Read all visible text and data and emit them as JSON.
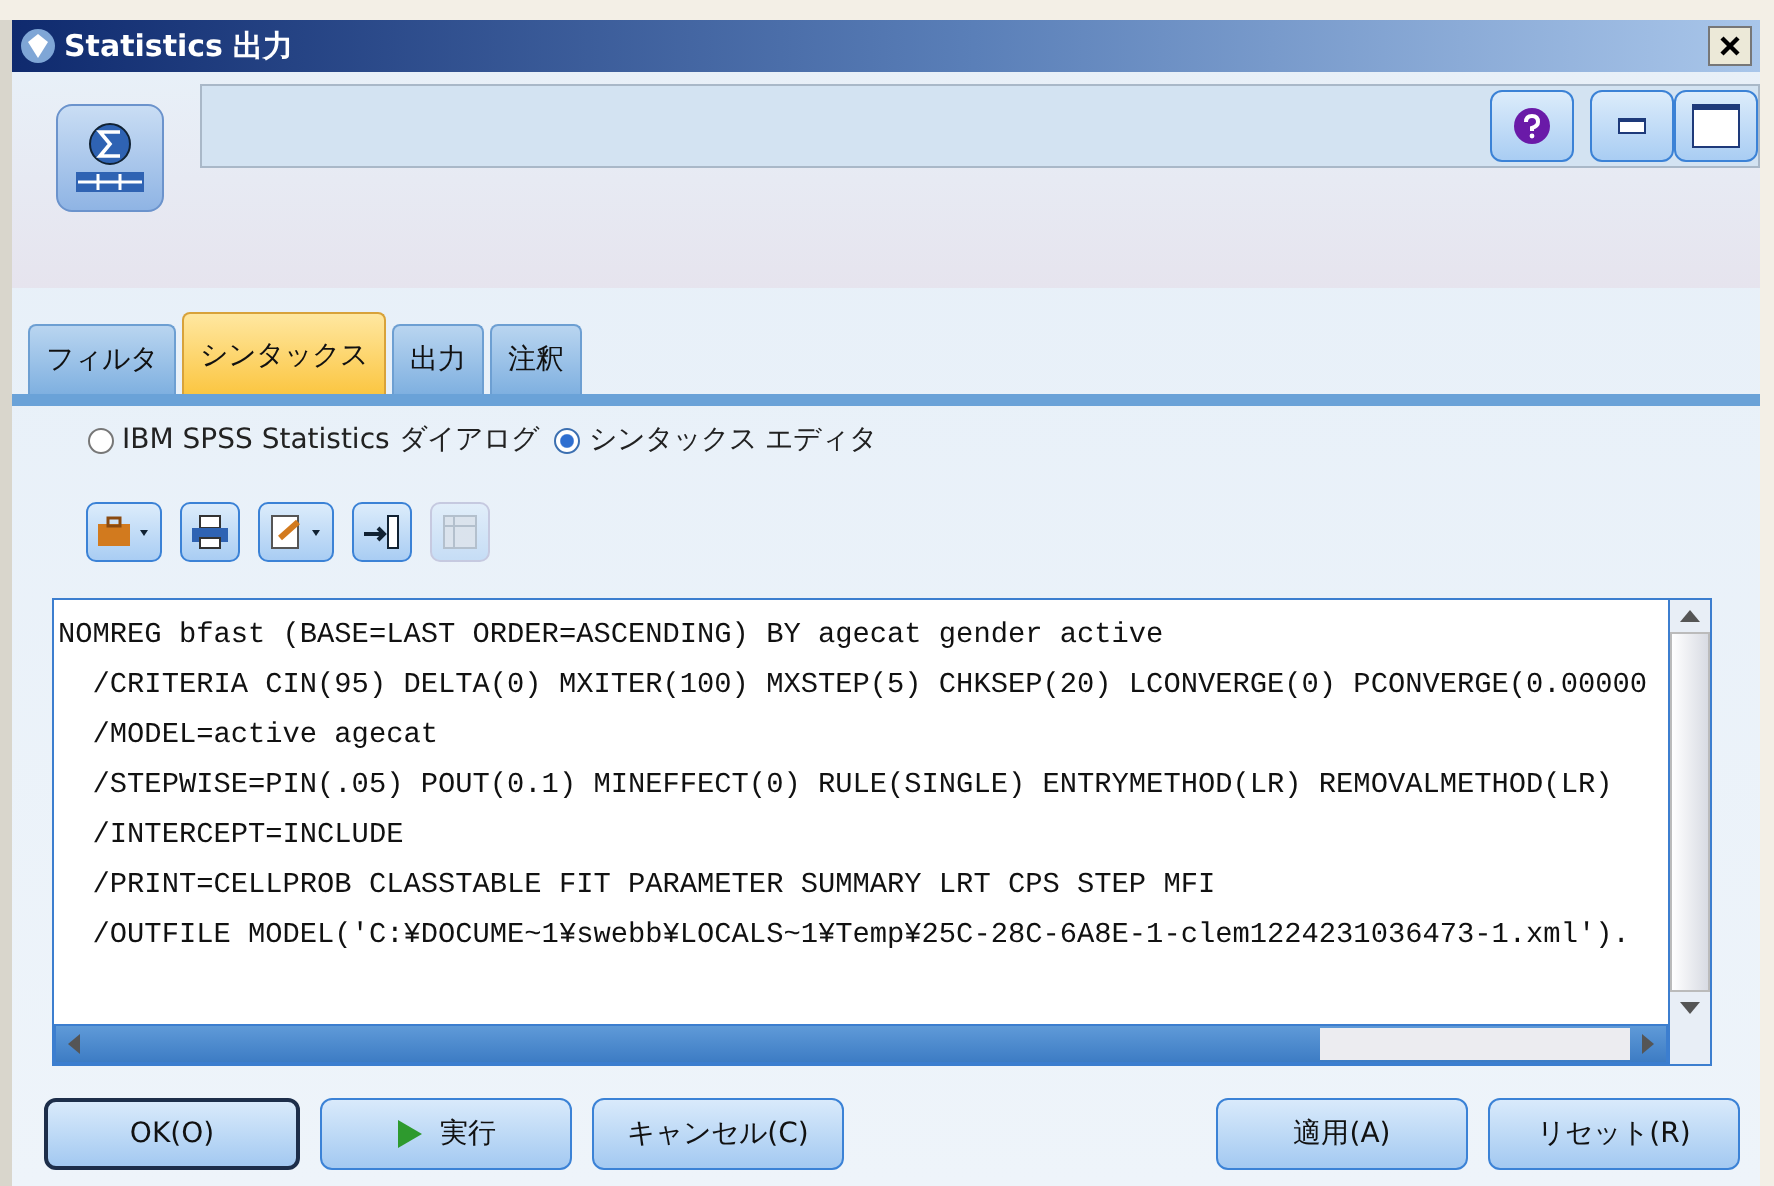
{
  "window": {
    "title": "Statistics 出力"
  },
  "tabs": [
    {
      "label": "フィルタ",
      "selected": false
    },
    {
      "label": "シンタックス",
      "selected": true
    },
    {
      "label": "出力",
      "selected": false
    },
    {
      "label": "注釈",
      "selected": false
    }
  ],
  "mode_options": [
    {
      "label": "IBM SPSS Statistics ダイアログ",
      "selected": false
    },
    {
      "label": "シンタックス エディタ",
      "selected": true
    }
  ],
  "toolbar": [
    {
      "kind": "open",
      "disabled": false
    },
    {
      "kind": "print",
      "disabled": false
    },
    {
      "kind": "edit",
      "disabled": false
    },
    {
      "kind": "insert",
      "disabled": false
    },
    {
      "kind": "grid",
      "disabled": true
    }
  ],
  "syntax_lines": [
    "NOMREG bfast (BASE=LAST ORDER=ASCENDING) BY agecat gender active",
    "  /CRITERIA CIN(95) DELTA(0) MXITER(100) MXSTEP(5) CHKSEP(20) LCONVERGE(0) PCONVERGE(0.00000",
    "  /MODEL=active agecat",
    "  /STEPWISE=PIN(.05) POUT(0.1) MINEFFECT(0) RULE(SINGLE) ENTRYMETHOD(LR) REMOVALMETHOD(LR)",
    "  /INTERCEPT=INCLUDE",
    "  /PRINT=CELLPROB CLASSTABLE FIT PARAMETER SUMMARY LRT CPS STEP MFI",
    "  /OUTFILE MODEL('C:¥DOCUME~1¥swebb¥LOCALS~1¥Temp¥25C-28C-6A8E-1-clem1224231036473-1.xml')."
  ],
  "buttons_left": [
    {
      "label": "OK(O)",
      "kind": "default"
    },
    {
      "label": "実行",
      "kind": "run"
    },
    {
      "label": "キャンセル(C)",
      "kind": "plain"
    }
  ],
  "buttons_right": [
    "適用(A)",
    "リセット(R)"
  ]
}
